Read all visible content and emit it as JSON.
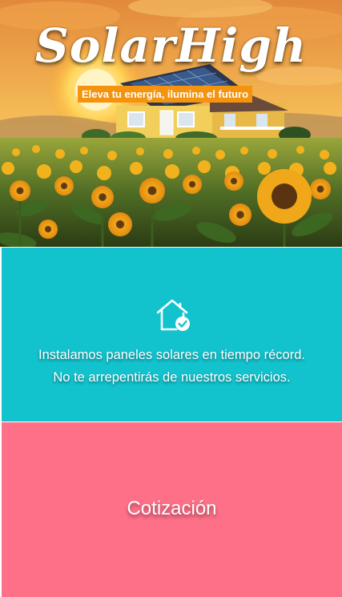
{
  "hero": {
    "brand": "SolarHigh",
    "tagline": "Eleva tu energía, ilumina el futuro",
    "image": "sunflower-field-house-solar-panels"
  },
  "features": {
    "icon": "home-check-icon",
    "line1": "Instalamos paneles solares en tiempo récord.",
    "line2": "No te arrepentirás de nuestros servicios."
  },
  "quote": {
    "label": "Cotización"
  },
  "colors": {
    "tagline_bg": "#f3930e",
    "features_bg": "#12c2cd",
    "quote_bg": "#fe7088",
    "text": "#ffffff"
  }
}
